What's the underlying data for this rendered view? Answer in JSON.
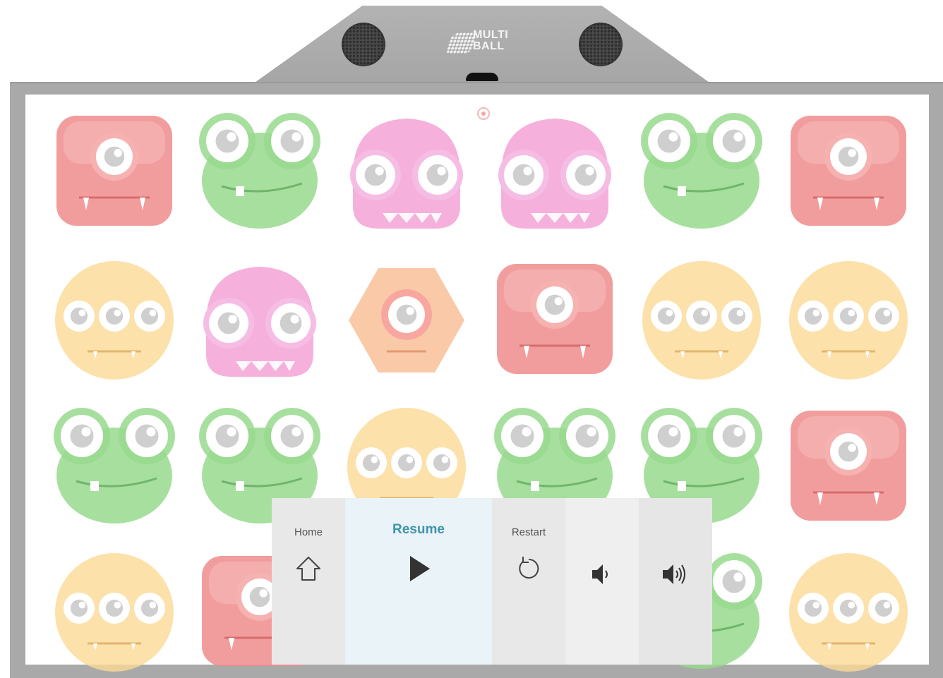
{
  "device": {
    "brand_logo_text": "MULTI BALL",
    "brand_line1": "MULTI",
    "brand_line2": "BALL"
  },
  "colors": {
    "red": "#f08c8c",
    "green": "#98d98e",
    "pink": "#f3a3d6",
    "yellow": "#fbd995",
    "orange": "#f8bb92",
    "menu_accent": "#3f95a8"
  },
  "board": {
    "rows": [
      [
        "red",
        "green",
        "pink",
        "pink",
        "green",
        "red"
      ],
      [
        "yellow",
        "pink",
        "orange",
        "red",
        "yellow",
        "yellow"
      ],
      [
        "green",
        "green",
        "yellow",
        "green",
        "green",
        "red"
      ],
      [
        "yellow",
        "red",
        "",
        "",
        "green",
        "yellow"
      ]
    ]
  },
  "pause_menu": {
    "home_label": "Home",
    "resume_label": "Resume",
    "restart_label": "Restart",
    "home_icon": "home-icon",
    "resume_icon": "play-icon",
    "restart_icon": "restart-icon",
    "volume_down_icon": "volume-down-icon",
    "volume_up_icon": "volume-up-icon"
  }
}
